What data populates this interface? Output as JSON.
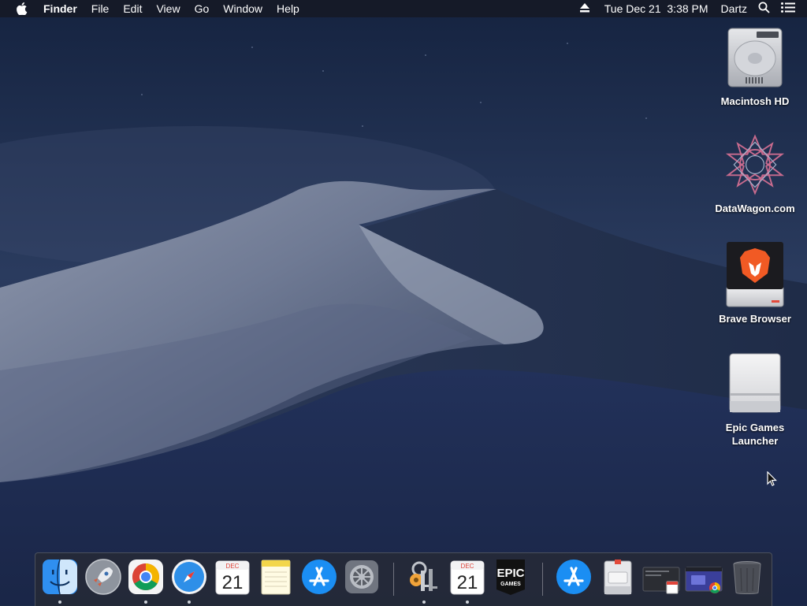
{
  "menubar": {
    "app_name": "Finder",
    "menus": [
      "File",
      "Edit",
      "View",
      "Go",
      "Window",
      "Help"
    ],
    "clock": "Tue Dec 21  3:38 PM",
    "user": "Dartz",
    "icons": [
      "apple-icon",
      "eject-icon",
      "spotlight-search-icon",
      "notification-center-icon"
    ]
  },
  "desktop": {
    "icons": [
      {
        "label": "Macintosh HD",
        "icon": "hard-drive-icon"
      },
      {
        "label": "DataWagon.com",
        "icon": "network-volume-icon"
      },
      {
        "label": "Brave Browser",
        "icon": "brave-disk-image-icon"
      },
      {
        "label": "Epic Games Launcher",
        "icon": "external-drive-icon"
      }
    ]
  },
  "dock": {
    "items": [
      {
        "name": "finder",
        "running": true
      },
      {
        "name": "launchpad",
        "running": false
      },
      {
        "name": "chrome",
        "running": true
      },
      {
        "name": "safari",
        "running": true
      },
      {
        "name": "calendar",
        "running": false,
        "month": "DEC",
        "day": "21"
      },
      {
        "name": "notes",
        "running": false
      },
      {
        "name": "app-store",
        "running": false
      },
      {
        "name": "system-preferences",
        "running": false
      },
      {
        "name": "keychain-access",
        "running": true
      },
      {
        "name": "calendar-2",
        "running": true,
        "month": "DEC",
        "day": "21"
      },
      {
        "name": "epic-games",
        "running": false,
        "line1": "EPIC",
        "line2": "GAMES"
      },
      {
        "name": "app-store-downloads",
        "running": false
      },
      {
        "name": "installer-disk",
        "running": false
      },
      {
        "name": "recent-calendar-window",
        "running": false
      },
      {
        "name": "recent-chrome-window",
        "running": false
      },
      {
        "name": "trash",
        "running": false
      }
    ]
  }
}
